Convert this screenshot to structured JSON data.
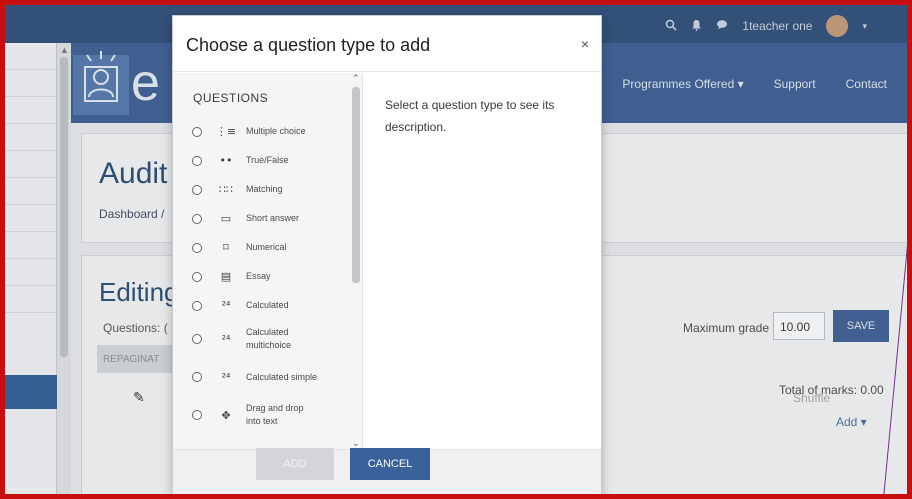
{
  "topbar": {
    "username": "1teacher one",
    "icons": [
      "search-icon",
      "bell-icon",
      "chat-icon"
    ]
  },
  "nav": {
    "items": [
      "Programmes Offered ▾",
      "Support",
      "Contact"
    ]
  },
  "logo": {
    "letter": "e"
  },
  "page": {
    "title": "Audit",
    "breadcrumb": "Dashboard /",
    "editing_heading": "Editing",
    "questions_label": "Questions: (",
    "repaginate_label": "REPAGINAT",
    "maximum_grade_label": "Maximum grade",
    "maximum_grade_value": "10.00",
    "save_label": "SAVE",
    "total_marks": "Total of marks: 0.00",
    "shuffle_label": "Shuffle",
    "add_label": "Add ▾"
  },
  "modal": {
    "title": "Choose a question type to add",
    "close_glyph": "×",
    "section_heading": "QUESTIONS",
    "description": "Select a question type to see its description.",
    "add_label": "ADD",
    "cancel_label": "CANCEL",
    "options": [
      {
        "label": "Multiple choice",
        "icon": "multiple-choice-icon",
        "glyph": "⋮≡"
      },
      {
        "label": "True/False",
        "icon": "true-false-icon",
        "glyph": "••"
      },
      {
        "label": "Matching",
        "icon": "matching-icon",
        "glyph": "∷∷"
      },
      {
        "label": "Short answer",
        "icon": "short-answer-icon",
        "glyph": "▭"
      },
      {
        "label": "Numerical",
        "icon": "numerical-icon",
        "glyph": "⌑"
      },
      {
        "label": "Essay",
        "icon": "essay-icon",
        "glyph": "▤"
      },
      {
        "label": "Calculated",
        "icon": "calculated-icon",
        "glyph": "²⁴"
      },
      {
        "label": "Calculated multichoice",
        "icon": "calculated-multichoice-icon",
        "glyph": "²⁴"
      },
      {
        "label": "Calculated simple",
        "icon": "calculated-simple-icon",
        "glyph": "²⁴"
      },
      {
        "label": "Drag and drop into text",
        "icon": "drag-drop-text-icon",
        "glyph": "✥"
      }
    ]
  }
}
